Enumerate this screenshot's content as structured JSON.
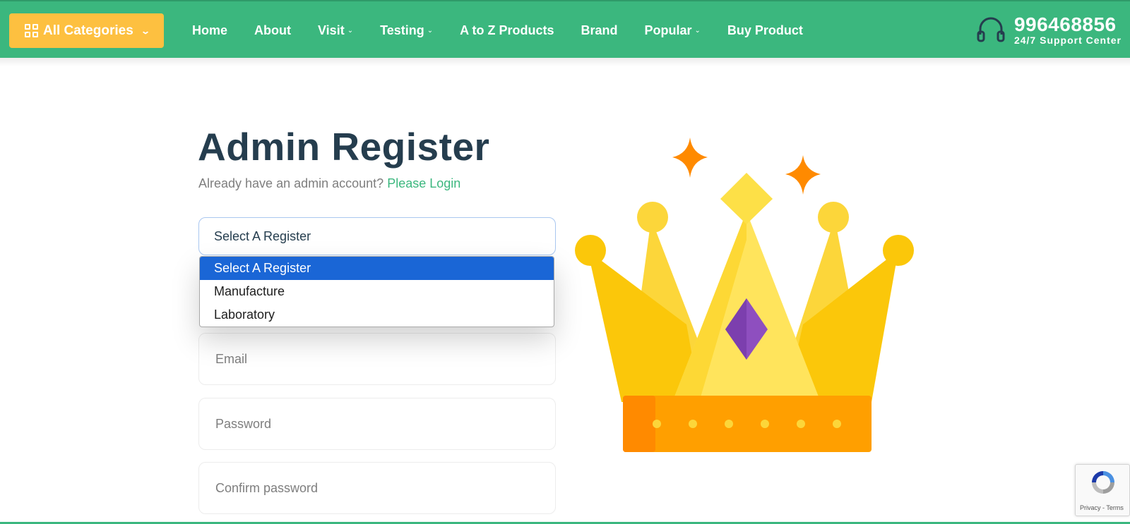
{
  "header": {
    "categories_label": "All Categories",
    "nav": [
      {
        "label": "Home",
        "has_caret": false
      },
      {
        "label": "About",
        "has_caret": false
      },
      {
        "label": "Visit",
        "has_caret": true
      },
      {
        "label": "Testing",
        "has_caret": true
      },
      {
        "label": "A to Z Products",
        "has_caret": false
      },
      {
        "label": "Brand",
        "has_caret": false
      },
      {
        "label": "Popular",
        "has_caret": true
      },
      {
        "label": "Buy Product",
        "has_caret": false
      }
    ],
    "support_phone": "996468856",
    "support_sub": "24/7 Support Center"
  },
  "form": {
    "title": "Admin Register",
    "subtitle_text": "Already have an admin account?",
    "login_link": "Please Login",
    "select_value": "Select A Register",
    "dropdown_options": [
      "Select A Register",
      "Manufacture",
      "Laboratory"
    ],
    "email_placeholder": "Email",
    "password_placeholder": "Password",
    "confirm_placeholder": "Confirm password"
  },
  "recaptcha": {
    "text": "Privacy - Terms"
  },
  "colors": {
    "brand_green": "#3bb77e",
    "accent_yellow": "#fdc040",
    "option_highlight": "#1a66d6"
  }
}
